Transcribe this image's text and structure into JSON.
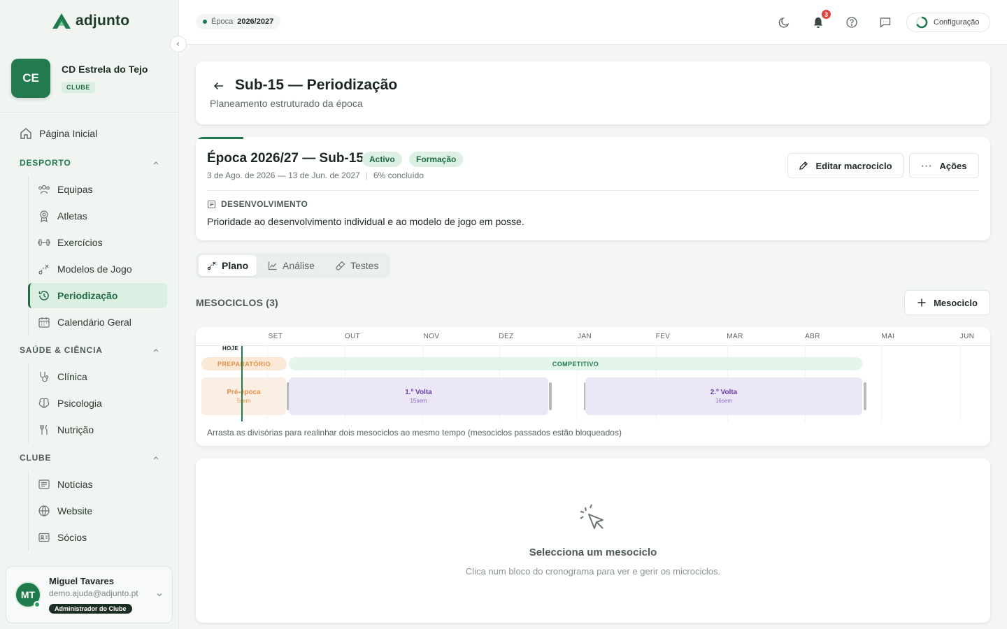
{
  "brand": {
    "name": "adjunto"
  },
  "club": {
    "initials": "CE",
    "name": "CD Estrela do Tejo",
    "badge": "CLUBE"
  },
  "sidebar": {
    "home": "Página Inicial",
    "sections": [
      {
        "title": "DESPORTO",
        "items": [
          "Equipas",
          "Atletas",
          "Exercícios",
          "Modelos de Jogo",
          "Periodização",
          "Calendário Geral"
        ]
      },
      {
        "title": "SAÚDE & CIÊNCIA",
        "items": [
          "Clínica",
          "Psicologia",
          "Nutrição"
        ]
      },
      {
        "title": "CLUBE",
        "items": [
          "Notícias",
          "Website",
          "Sócios"
        ]
      }
    ],
    "active_item": "Periodização"
  },
  "user": {
    "initials": "MT",
    "name": "Miguel Tavares",
    "email": "demo.ajuda@adjunto.pt",
    "role": "Administrador do Clube"
  },
  "topbar": {
    "season_label": "Época",
    "season_value": "2026/2027",
    "notifications": "3",
    "config_label": "Configuração"
  },
  "header": {
    "title": "Sub-15 — Periodização",
    "subtitle": "Planeamento estruturado da época"
  },
  "macro": {
    "title": "Época 2026/27 — Sub-15",
    "tags": [
      "Activo",
      "Formação"
    ],
    "dates": "3 de Ago. de 2026 — 13 de Jun. de 2027",
    "separator": "|",
    "progress": "6% concluído",
    "progress_value": 0.06,
    "edit_label": "Editar macrociclo",
    "actions_label": "Ações",
    "focus_label": "DESENVOLVIMENTO",
    "focus_text": "Prioridade ao desenvolvimento individual e ao modelo de jogo em posse."
  },
  "tabs": [
    "Plano",
    "Análise",
    "Testes"
  ],
  "active_tab": "Plano",
  "mesocycles": {
    "title": "MESOCICLOS (3)",
    "add_label": "Mesociclo",
    "months": [
      "SET",
      "OUT",
      "NOV",
      "DEZ",
      "JAN",
      "FEV",
      "MAR",
      "ABR",
      "MAI",
      "JUN"
    ],
    "today_label": "HOJE",
    "phases": [
      {
        "name": "PREPARATÓRIO",
        "color": "#fbe8d6"
      },
      {
        "name": "COMPETITIVO",
        "color": "#e4f5ea"
      }
    ],
    "blocks": [
      {
        "name": "Pré-época",
        "weeks": "5sem",
        "color": "#fbeee4"
      },
      {
        "name": "1.º Volta",
        "weeks": "15sem",
        "color": "#ece7f6"
      },
      {
        "name": "2.º Volta",
        "weeks": "16sem",
        "color": "#ece7f6"
      }
    ],
    "hint": "Arrasta as divisórias para realinhar dois mesociclos ao mesmo tempo (mesociclos passados estão bloqueados)"
  },
  "empty_state": {
    "title": "Selecciona um mesociclo",
    "subtitle": "Clica num bloco do cronograma para ver e gerir os microciclos."
  },
  "colors": {
    "accent": "#1f7a4c",
    "accent_soft": "#dcefe3",
    "danger": "#e0413d",
    "meso_text": "#6b3fa8",
    "prep_text": "#e0934a"
  }
}
